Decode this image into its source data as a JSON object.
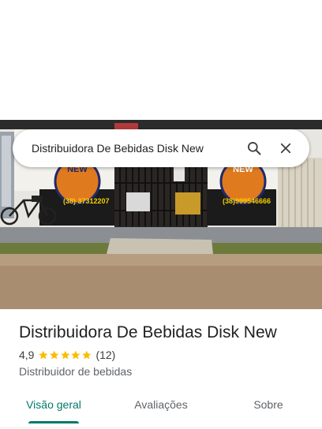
{
  "search": {
    "query": "Distribuidora De Bebidas Disk New",
    "search_icon": "search-icon",
    "close_icon": "close-icon"
  },
  "photo": {
    "sign_left_phone": "(38) 37312207",
    "sign_right_phone": "(38)999546666",
    "sign_text": "NEW"
  },
  "place": {
    "title": "Distribuidora De Bebidas Disk New",
    "rating": "4,9",
    "stars": 5,
    "reviews": "(12)",
    "category": "Distribuidor de bebidas"
  },
  "tabs": [
    {
      "label": "Visão geral",
      "active": true
    },
    {
      "label": "Avaliações",
      "active": false
    },
    {
      "label": "Sobre",
      "active": false
    }
  ],
  "colors": {
    "accent": "#00796b",
    "star": "#fbbc04"
  }
}
